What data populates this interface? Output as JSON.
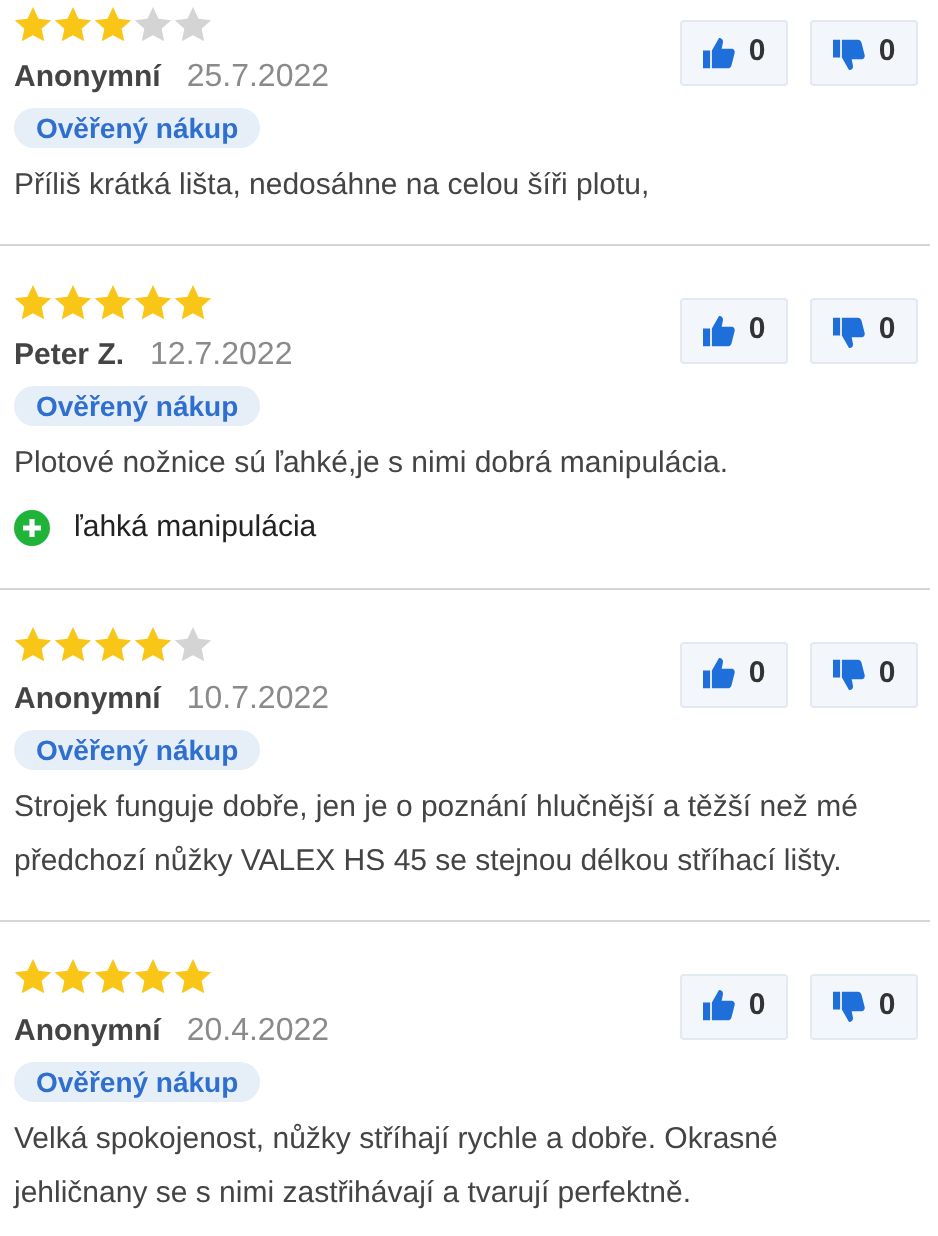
{
  "reviews": [
    {
      "stars": 3,
      "author": "Anonymní",
      "date": "25.7.2022",
      "badge": "Ověřený nákup",
      "text": "Příliš krátká lišta, nedosáhne na celou šíři plotu,",
      "likes": "0",
      "dislikes": "0"
    },
    {
      "stars": 5,
      "author": "Peter Z.",
      "date": "12.7.2022",
      "badge": "Ověřený nákup",
      "text": "Plotové nožnice sú ľahké,je s nimi dobrá manipulácia.",
      "pros": [
        "ľahká manipulácia"
      ],
      "likes": "0",
      "dislikes": "0"
    },
    {
      "stars": 4,
      "author": "Anonymní",
      "date": "10.7.2022",
      "badge": "Ověřený nákup",
      "text": "Strojek funguje dobře, jen je o poznání hlučnější a těžší než mé předchozí nůžky VALEX HS 45 se stejnou délkou stříhací lišty.",
      "likes": "0",
      "dislikes": "0"
    },
    {
      "stars": 5,
      "author": "Anonymní",
      "date": "20.4.2022",
      "badge": "Ověřený nákup",
      "text": "Velká spokojenost, nůžky stříhají rychle a dobře. Okrasné jehličnany se s nimi zastřihávají a tvarují perfektně.",
      "likes": "0",
      "dislikes": "0"
    }
  ]
}
